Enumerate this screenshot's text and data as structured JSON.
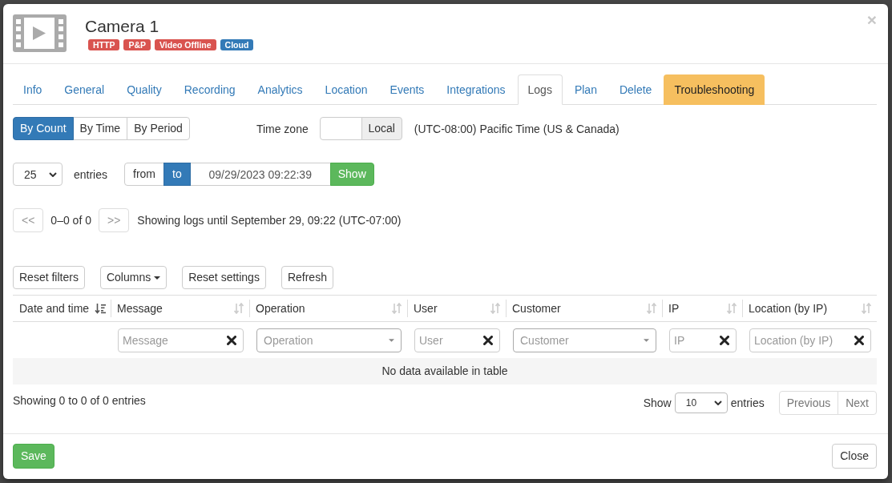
{
  "window": {
    "title": "Camera 1",
    "close": "×"
  },
  "badges": [
    {
      "label": "HTTP",
      "color": "#d9534f"
    },
    {
      "label": "P&P",
      "color": "#d9534f"
    },
    {
      "label": "Video Offline",
      "color": "#d9534f"
    },
    {
      "label": "Cloud",
      "color": "#337ab7"
    }
  ],
  "tabs": [
    {
      "label": "Info",
      "kind": "link",
      "selected": false
    },
    {
      "label": "General",
      "kind": "link",
      "selected": false
    },
    {
      "label": "Quality",
      "kind": "link",
      "selected": false
    },
    {
      "label": "Recording",
      "kind": "link",
      "selected": false
    },
    {
      "label": "Analytics",
      "kind": "link",
      "selected": false
    },
    {
      "label": "Location",
      "kind": "link",
      "selected": false
    },
    {
      "label": "Events",
      "kind": "link",
      "selected": false
    },
    {
      "label": "Integrations",
      "kind": "link",
      "selected": false
    },
    {
      "label": "Logs",
      "kind": "link",
      "selected": true
    },
    {
      "label": "Plan",
      "kind": "link",
      "selected": false
    },
    {
      "label": "Delete",
      "kind": "link",
      "selected": false
    },
    {
      "label": "Troubleshooting",
      "kind": "warning",
      "selected": false
    }
  ],
  "mode_buttons": [
    {
      "label": "By Count",
      "selected": true
    },
    {
      "label": "By Time",
      "selected": false
    },
    {
      "label": "By Period",
      "selected": false
    }
  ],
  "time_zone": {
    "label": "Time zone",
    "addon": "Local",
    "description": "(UTC-08:00) Pacific Time (US & Canada)"
  },
  "limit": {
    "value": "25",
    "label": "entries"
  },
  "range": {
    "directions": [
      {
        "label": "from",
        "selected": false
      },
      {
        "label": "to",
        "selected": true
      }
    ],
    "value": "09/29/2023 09:22:39",
    "button": "Show"
  },
  "pager": {
    "prev": {
      "label": "<<",
      "disabled": true
    },
    "count": "0–0 of 0",
    "next": {
      "label": ">>",
      "disabled": true
    },
    "summary": "Showing logs until September 29, 09:22 (UTC-07:00)"
  },
  "toolbar": [
    {
      "label": "Reset filters",
      "dropdown": false
    },
    {
      "label": "Columns",
      "dropdown": true
    },
    {
      "label": "Reset settings",
      "dropdown": false
    },
    {
      "label": "Refresh",
      "dropdown": false
    }
  ],
  "table": {
    "columns": [
      {
        "label": "Date and time",
        "sorted": true
      },
      {
        "label": "Message",
        "sorted": false,
        "filter": {
          "kind": "text",
          "placeholder": "Message"
        }
      },
      {
        "label": "Operation",
        "sorted": false,
        "filter": {
          "kind": "select",
          "placeholder": "Operation"
        }
      },
      {
        "label": "User",
        "sorted": false,
        "filter": {
          "kind": "text",
          "placeholder": "User"
        }
      },
      {
        "label": "Customer",
        "sorted": false,
        "filter": {
          "kind": "select",
          "placeholder": "Customer"
        }
      },
      {
        "label": "IP",
        "sorted": false,
        "filter": {
          "kind": "text",
          "placeholder": "IP"
        }
      },
      {
        "label": "Location (by IP)",
        "sorted": false,
        "filter": {
          "kind": "text",
          "placeholder": "Location (by IP)"
        }
      }
    ],
    "empty_message": "No data available in table"
  },
  "table_footer": {
    "info": "Showing 0 to 0 of 0 entries",
    "length": {
      "label_before": "Show",
      "value": "10",
      "label_after": "entries"
    },
    "pagination": [
      {
        "label": "Previous",
        "disabled": true
      },
      {
        "label": "Next",
        "disabled": true
      }
    ]
  },
  "footer": {
    "buttons": [
      {
        "label": "Save",
        "kind": "success"
      },
      {
        "label": "Close",
        "kind": "default"
      }
    ]
  }
}
